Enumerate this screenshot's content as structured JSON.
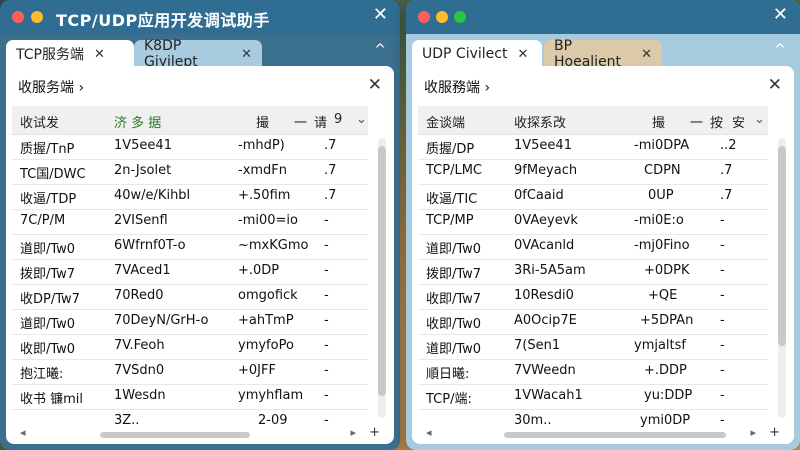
{
  "colors": {
    "close_red": "#ff5f57",
    "minimize_yellow": "#febc2e",
    "zoom_green": "#28c840",
    "titlebar_blue": "#2f6e92"
  },
  "left": {
    "title": "TCP/UDP应用开发调试助手",
    "tabs": [
      {
        "label": "TCP服务端",
        "close": "✕"
      },
      {
        "label": "K8DP Giyilept",
        "close": "✕"
      }
    ],
    "breadcrumb": "收服务端 ›",
    "columns": [
      "收试发",
      "济 多 据",
      "撮",
      "一",
      "请",
      "9"
    ],
    "rows": [
      [
        "质握/TnP",
        "1V5ee41",
        "-mhdP)",
        ".7"
      ],
      [
        "TC国/DWC",
        "2n-Jsolet",
        "-xmdFn",
        ".7"
      ],
      [
        "收逼/TDP",
        "40w/e/Kihbl",
        "+.50fim",
        ".7"
      ],
      [
        "7C/P/M",
        "2VISenfl",
        "-mi00=io",
        "-"
      ],
      [
        "道即/Tw0",
        "6Wfrnf0T-o",
        "~mxKGmo",
        "-"
      ],
      [
        "拨即/Tw7",
        "7VAced1",
        "+.0DP",
        "-"
      ],
      [
        "收DP/Tw7",
        "70Red0",
        "omgofick",
        "-"
      ],
      [
        "道即/Tw0",
        "70DeyN/GrH-o",
        "+ahTmP",
        "-"
      ],
      [
        "收即/Tw0",
        "7V.Feoh",
        "ymyfoPo",
        "-"
      ],
      [
        "抱江曦:",
        "7VSdn0",
        "+0JFF",
        "-"
      ],
      [
        "收书 镰mil",
        "1Wesdn",
        "ymyhflam",
        "-"
      ],
      [
        "",
        "3Z..",
        "2-09",
        "-"
      ]
    ]
  },
  "right": {
    "tabs": [
      {
        "label": "UDP Civilect",
        "close": "✕"
      },
      {
        "label": "BP Hoealient",
        "close": "✕"
      }
    ],
    "breadcrumb": "收服務端 ›",
    "columns": [
      "金谈端",
      "收探系改",
      "撮",
      "一",
      "按",
      "安"
    ],
    "rows": [
      [
        "质握/DP",
        "1V5ee41",
        "-mi0DPA",
        "..2"
      ],
      [
        "TCP/LMC",
        "9fMeyach",
        "CDPN",
        ".7"
      ],
      [
        "收逼/TIC",
        "0fCaaid",
        "0UP",
        ".7"
      ],
      [
        "TCP/MP",
        "0VAeyevk",
        "-mi0E:o",
        "-"
      ],
      [
        "道即/Tw0",
        "0VAcanld",
        "-mj0Fino",
        "-"
      ],
      [
        "拨即/Tw7",
        "3Ri-5A5am",
        "+0DPK",
        "-"
      ],
      [
        "收即/Tw7",
        "10Resdi0",
        "+QE",
        "-"
      ],
      [
        "收即/Tw0",
        "A0Ocip7E",
        "+5DPAn",
        "-"
      ],
      [
        "道即/Tw0",
        "7(Sen1",
        "ymjaltsf",
        "-"
      ],
      [
        "順日曦:",
        "7VWeedn",
        "+.DDP",
        "-"
      ],
      [
        "TCP/端:",
        "1VWacah1",
        "yu:DDP",
        "-"
      ],
      [
        "",
        "30m..",
        "ymi0DP",
        "-"
      ]
    ]
  },
  "icons": {
    "panel_close": "✕",
    "window_close": "✕",
    "collapse": "^",
    "sort": "⌄",
    "scroll_left": "◂",
    "scroll_right": "▸",
    "add": "+"
  }
}
